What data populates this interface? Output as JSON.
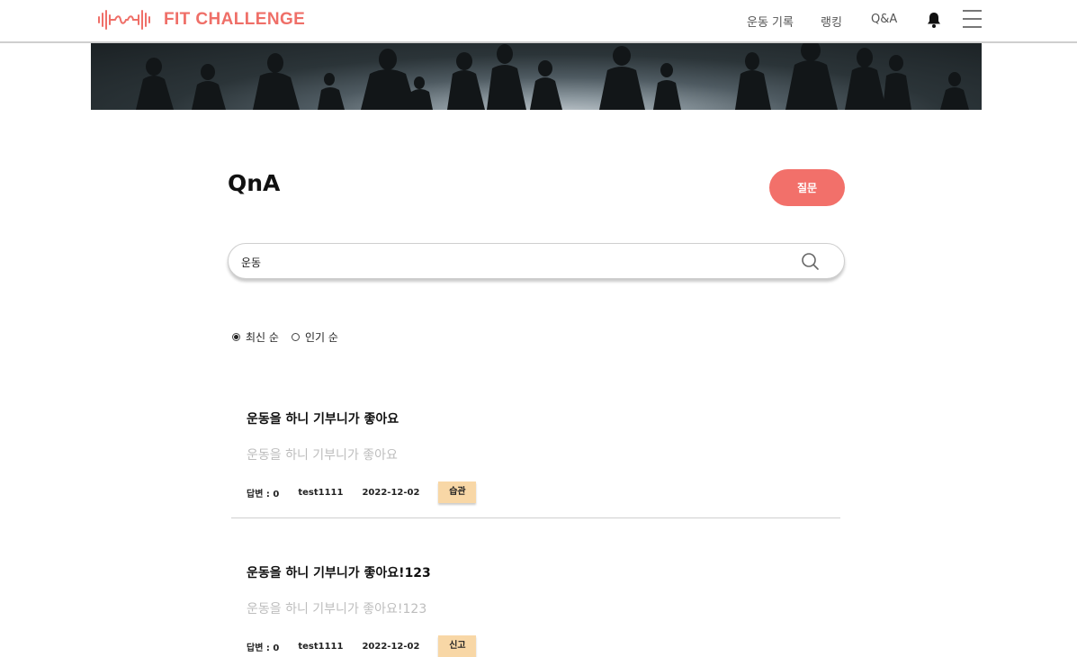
{
  "header": {
    "logo_text": "FIT CHALLENGE",
    "nav": [
      "운동 기록",
      "랭킹",
      "Q&A"
    ],
    "brand_color": "#ef6f68"
  },
  "page": {
    "title": "QnA",
    "ask_button": "질문"
  },
  "search": {
    "value": "운동",
    "icon": "search-icon"
  },
  "sort": {
    "options": [
      "최신 순",
      "인기 순"
    ],
    "selected": "최신 순"
  },
  "posts": [
    {
      "title": "운동을 하니 기부니가 좋아요",
      "body": "운동을 하니 기부니가 좋아요",
      "answers": "답변 : 0",
      "author": "test1111",
      "date": "2022-12-02",
      "tag": "습관"
    },
    {
      "title": "운동을 하니 기부니가 좋아요!123",
      "body": "운동을 하니 기부니가 좋아요!123",
      "answers": "답변 : 0",
      "author": "test1111",
      "date": "2022-12-02",
      "tag": "신고"
    }
  ]
}
